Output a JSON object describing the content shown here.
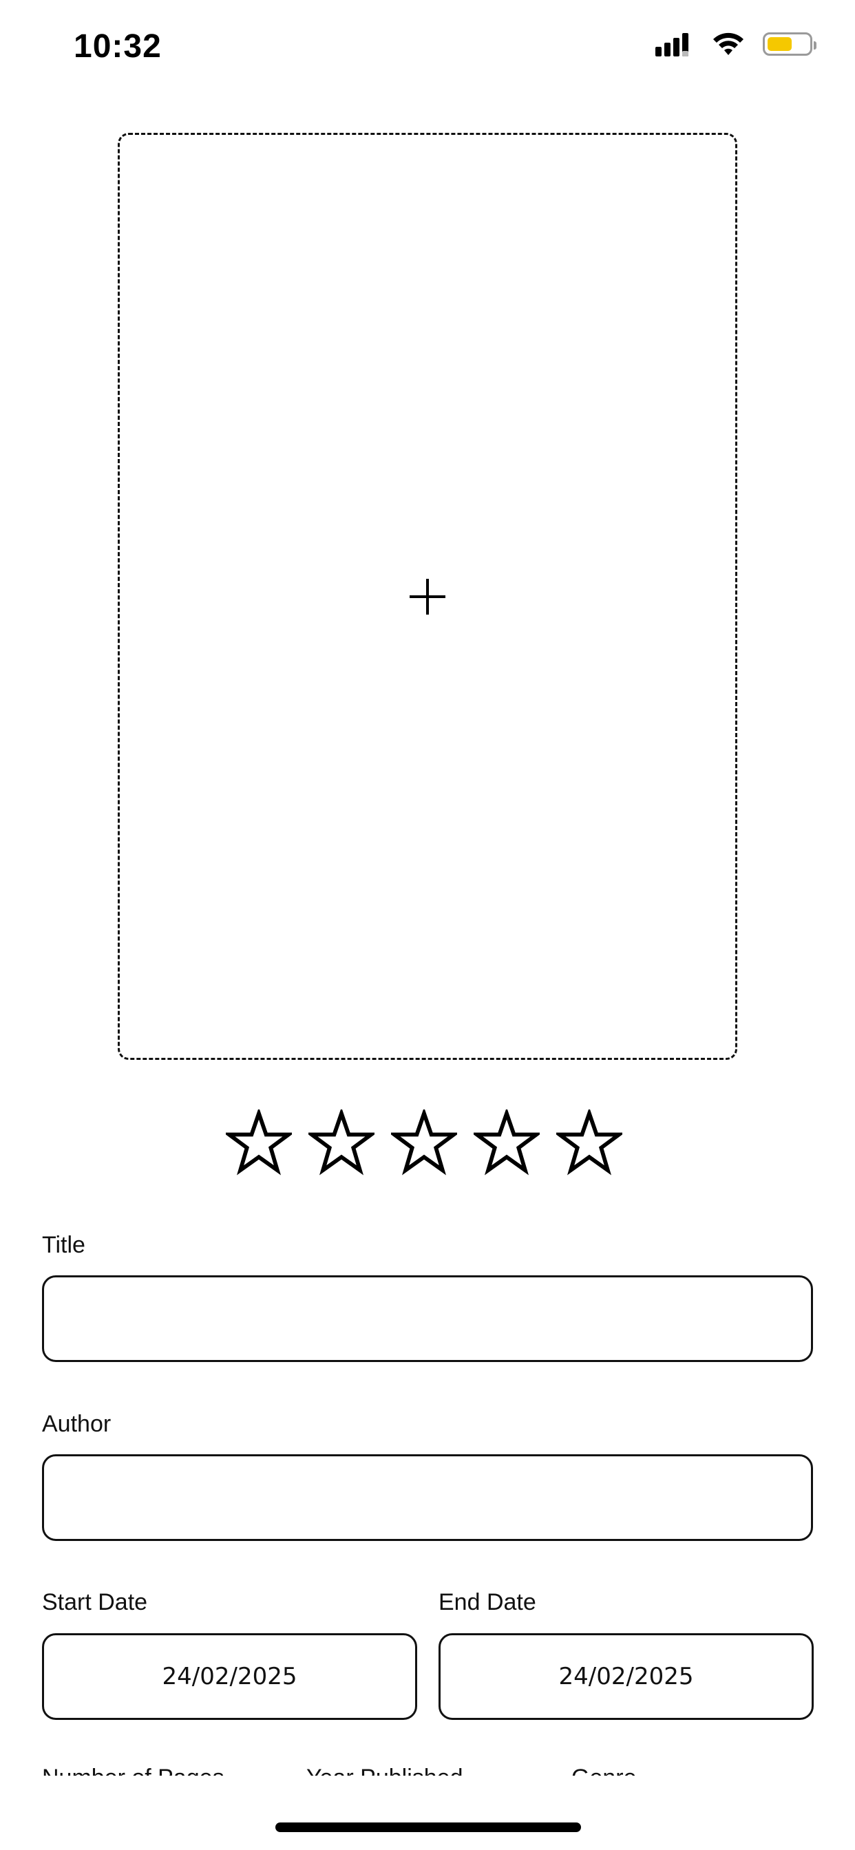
{
  "status_bar": {
    "time": "10:32",
    "icons": [
      "signal-icon",
      "wifi-icon",
      "battery-icon"
    ],
    "battery_level": 0.6,
    "battery_color": "#f5c800"
  },
  "cover": {
    "icon": "plus-icon"
  },
  "rating": {
    "value": 0,
    "max": 5,
    "icon": "star-outline-icon"
  },
  "form": {
    "title_label": "Title",
    "title_value": "",
    "author_label": "Author",
    "author_value": "",
    "start_date_label": "Start Date",
    "start_date_value": "24/02/2025",
    "end_date_label": "End Date",
    "end_date_value": "24/02/2025",
    "pages_label": "Number of Pages",
    "year_label": "Year Published",
    "genre_label": "Genre"
  }
}
